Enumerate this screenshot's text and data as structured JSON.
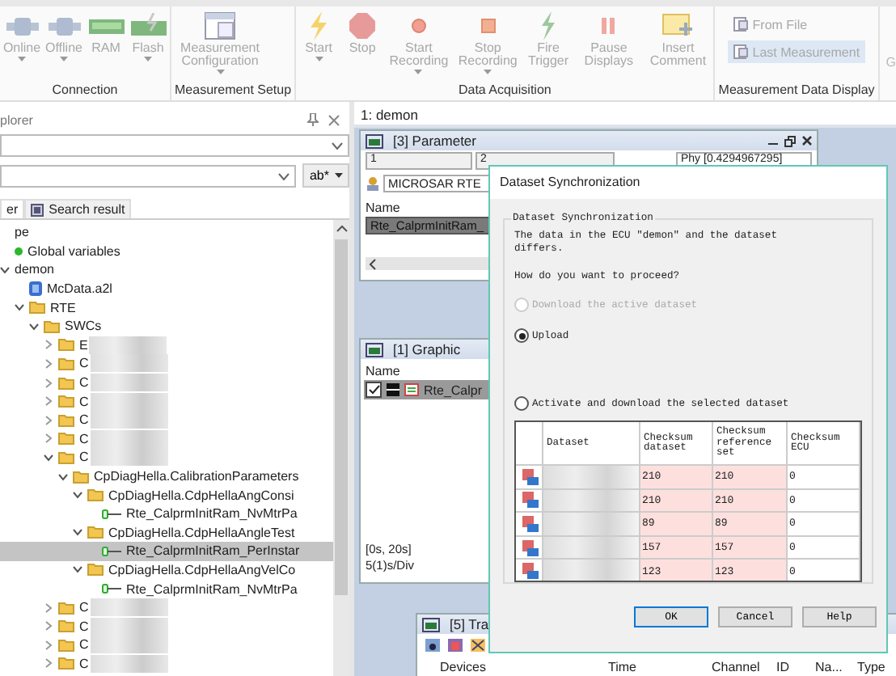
{
  "ribbon": {
    "groups": [
      {
        "label": "Connection",
        "buttons": [
          {
            "label": "Online",
            "dropdown": true,
            "disabled": true
          },
          {
            "label": "Offline",
            "dropdown": true,
            "disabled": true
          },
          {
            "label": "RAM",
            "dropdown": false,
            "disabled": true
          },
          {
            "label": "Flash",
            "dropdown": true,
            "disabled": true
          }
        ]
      },
      {
        "label": "Measurement Setup",
        "buttons": [
          {
            "label": "Measurement Configuration",
            "dropdown": true,
            "disabled": true
          }
        ]
      },
      {
        "label": "Data Acquisition",
        "buttons": [
          {
            "label": "Start",
            "dropdown": true,
            "disabled": true
          },
          {
            "label": "Stop",
            "dropdown": false,
            "disabled": true
          },
          {
            "label": "Start Recording",
            "dropdown": true,
            "disabled": true
          },
          {
            "label": "Stop Recording",
            "dropdown": true,
            "disabled": true
          },
          {
            "label": "Fire Trigger",
            "dropdown": false,
            "disabled": true
          },
          {
            "label": "Pause Displays",
            "dropdown": false,
            "disabled": true
          },
          {
            "label": "Insert Comment",
            "dropdown": false,
            "disabled": true
          }
        ]
      },
      {
        "label": "Measurement Data Display",
        "small_buttons": [
          {
            "label": "From File",
            "selected": false
          },
          {
            "label": "Last Measurement",
            "selected": true
          }
        ]
      }
    ],
    "cut_label": "G"
  },
  "explorer": {
    "title": "plorer",
    "search_option": "ab*",
    "tabs": [
      {
        "label": "er",
        "selected": true
      },
      {
        "label": "Search result",
        "selected": false
      }
    ],
    "tree": [
      {
        "label": "pe",
        "kind": "root",
        "selected": false
      },
      {
        "label": "Global variables",
        "kind": "variable",
        "selected": false
      },
      {
        "label": "demon",
        "kind": "root",
        "expanded": true,
        "selected": false,
        "children": [
          {
            "label": "McData.a2l",
            "kind": "file",
            "selected": false
          },
          {
            "label": "RTE",
            "kind": "folder",
            "expanded": true,
            "selected": false,
            "children": [
              {
                "label": "SWCs",
                "kind": "folder",
                "expanded": true,
                "selected": false,
                "children": [
                  {
                    "label": "E",
                    "kind": "folder",
                    "expanded": false,
                    "selected": false,
                    "redacted": true
                  },
                  {
                    "label": "C",
                    "kind": "folder",
                    "expanded": false,
                    "selected": false,
                    "redacted": true
                  },
                  {
                    "label": "C",
                    "kind": "folder",
                    "expanded": false,
                    "selected": false,
                    "redacted": true
                  },
                  {
                    "label": "C",
                    "kind": "folder",
                    "expanded": false,
                    "selected": false,
                    "redacted": true
                  },
                  {
                    "label": "C",
                    "kind": "folder",
                    "expanded": false,
                    "selected": false,
                    "redacted": true
                  },
                  {
                    "label": "C",
                    "kind": "folder",
                    "expanded": false,
                    "selected": false,
                    "redacted": true
                  },
                  {
                    "label": "C",
                    "kind": "folder",
                    "expanded": true,
                    "selected": false,
                    "redacted": true,
                    "children": [
                      {
                        "label": "CpDiagHella.CalibrationParameters",
                        "kind": "folder",
                        "expanded": true,
                        "selected": false,
                        "children": [
                          {
                            "label": "CpDiagHella.CdpHellaAngConsi",
                            "kind": "folder",
                            "expanded": true,
                            "selected": false,
                            "children": [
                              {
                                "label": "Rte_CalprmInitRam_NvMtrPa",
                                "kind": "parameter",
                                "selected": false
                              }
                            ]
                          },
                          {
                            "label": "CpDiagHella.CdpHellaAngleTest",
                            "kind": "folder",
                            "expanded": true,
                            "selected": false,
                            "children": [
                              {
                                "label": "Rte_CalprmInitRam_PerInstar",
                                "kind": "parameter",
                                "selected": true
                              }
                            ]
                          },
                          {
                            "label": "CpDiagHella.CdpHellaAngVelCo",
                            "kind": "folder",
                            "expanded": true,
                            "selected": false,
                            "children": [
                              {
                                "label": "Rte_CalprmInitRam_NvMtrPa",
                                "kind": "parameter",
                                "selected": false
                              }
                            ]
                          }
                        ]
                      }
                    ]
                  },
                  {
                    "label": "C",
                    "kind": "folder",
                    "expanded": false,
                    "selected": false,
                    "redacted": true
                  },
                  {
                    "label": "C",
                    "kind": "folder",
                    "expanded": false,
                    "selected": false,
                    "redacted": true
                  },
                  {
                    "label": "C",
                    "kind": "folder",
                    "expanded": false,
                    "selected": false,
                    "redacted": true
                  },
                  {
                    "label": "C",
                    "kind": "folder",
                    "expanded": false,
                    "selected": false,
                    "redacted": true
                  }
                ]
              }
            ]
          }
        ]
      }
    ]
  },
  "document_tab": "1: demon",
  "parameter_window": {
    "title": "[3] Parameter",
    "index_1": "1",
    "index_2": "2",
    "phys": "Phy [0.4294967295]",
    "source": "MICROSAR RTE",
    "column": "Name",
    "row": "Rte_CalprmInitRam_"
  },
  "graphic_window": {
    "title": "[1] Graphic",
    "column": "Name",
    "signal": {
      "label": "Rte_Calpr",
      "checked": true
    },
    "range": "[0s, 20s]",
    "scale": "5(1)s/Div"
  },
  "trace_window": {
    "title": "[5] Tra",
    "columns": [
      "Devices",
      "Time",
      "Channel",
      "ID",
      "Na...",
      "Type"
    ]
  },
  "dialog": {
    "title": "Dataset Synchronization",
    "group_title": "Dataset Synchronization",
    "message": "The data in the ECU \"demon\" and the dataset differs.",
    "question": "How do you want to proceed?",
    "options": [
      {
        "label": "Download the active dataset",
        "selected": false,
        "disabled": true
      },
      {
        "label": "Upload",
        "selected": true,
        "disabled": false
      },
      {
        "label": "Activate and download the selected dataset",
        "selected": false,
        "disabled": false
      }
    ],
    "table": {
      "columns": [
        "Dataset",
        "Checksum dataset",
        "Checksum reference set",
        "Checksum ECU"
      ],
      "rows": [
        {
          "checksum_dataset": "210",
          "checksum_reference": "210",
          "checksum_ecu": "0",
          "mismatch": true
        },
        {
          "checksum_dataset": "210",
          "checksum_reference": "210",
          "checksum_ecu": "0",
          "mismatch": true
        },
        {
          "checksum_dataset": "89",
          "checksum_reference": "89",
          "checksum_ecu": "0",
          "mismatch": true
        },
        {
          "checksum_dataset": "157",
          "checksum_reference": "157",
          "checksum_ecu": "0",
          "mismatch": true
        },
        {
          "checksum_dataset": "123",
          "checksum_reference": "123",
          "checksum_ecu": "0",
          "mismatch": true
        }
      ]
    },
    "buttons": [
      {
        "label": "OK",
        "kind": "default"
      },
      {
        "label": "Cancel",
        "kind": "normal"
      },
      {
        "label": "Help",
        "kind": "normal"
      }
    ]
  }
}
